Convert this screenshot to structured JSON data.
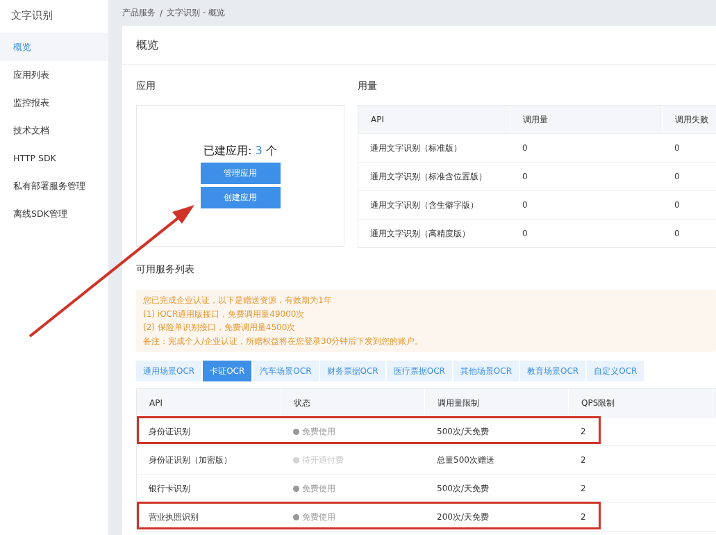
{
  "sidebar": {
    "title": "文字识别",
    "items": [
      {
        "label": "概览",
        "selected": true
      },
      {
        "label": "应用列表",
        "selected": false
      },
      {
        "label": "监控报表",
        "selected": false
      },
      {
        "label": "技术文档",
        "selected": false
      },
      {
        "label": "HTTP SDK",
        "selected": false
      },
      {
        "label": "私有部署服务管理",
        "selected": false
      },
      {
        "label": "离线SDK管理",
        "selected": false
      }
    ]
  },
  "breadcrumb": [
    "产品服务",
    "/",
    "文字识别 - 概览"
  ],
  "page_title": "概览",
  "apps": {
    "heading": "应用",
    "count_label": "已建应用:",
    "count": "3",
    "unit": "个",
    "buttons": [
      "管理应用",
      "创建应用"
    ]
  },
  "usage": {
    "heading": "用量",
    "columns": [
      "API",
      "调用量",
      "调用失败"
    ],
    "rows": [
      [
        "通用文字识别（标准版）",
        "0",
        "0"
      ],
      [
        "通用文字识别（标准含位置版）",
        "0",
        "0"
      ],
      [
        "通用文字识别（含生僻字版）",
        "0",
        "0"
      ],
      [
        "通用文字识别（高精度版）",
        "0",
        "0"
      ]
    ]
  },
  "services": {
    "heading": "可用服务列表",
    "notice": [
      "您已完成企业认证，以下是赠送资源，有效期为1年",
      "(1) iOCR通用版接口，免费调用量49000次",
      "(2) 保险单识别接口，免费调用量4500次",
      "备注：完成个人/企业认证，所赠权益将在您登录30分钟后下发到您的账户。"
    ],
    "tabs": [
      {
        "label": "通用场景OCR",
        "selected": false
      },
      {
        "label": "卡证OCR",
        "selected": true
      },
      {
        "label": "汽车场景OCR",
        "selected": false
      },
      {
        "label": "财务票据OCR",
        "selected": false
      },
      {
        "label": "医疗票据OCR",
        "selected": false
      },
      {
        "label": "其他场景OCR",
        "selected": false
      },
      {
        "label": "教育场景OCR",
        "selected": false
      },
      {
        "label": "自定义OCR",
        "selected": false
      }
    ],
    "columns": [
      "API",
      "状态",
      "调用量限制",
      "QPS限制"
    ],
    "rows": [
      {
        "api": "身份证识别",
        "status": "免费使用",
        "available": true,
        "limit": "500次/天免费",
        "qps": "2",
        "highlighted": true
      },
      {
        "api": "身份证识别（加密版）",
        "status": "待开通付费",
        "available": false,
        "limit": "总量500次赠送",
        "qps": "2",
        "highlighted": false
      },
      {
        "api": "银行卡识别",
        "status": "免费使用",
        "available": true,
        "limit": "500次/天免费",
        "qps": "2",
        "highlighted": false
      },
      {
        "api": "营业执照识别",
        "status": "免费使用",
        "available": true,
        "limit": "200次/天免费",
        "qps": "2",
        "highlighted": true
      }
    ]
  }
}
